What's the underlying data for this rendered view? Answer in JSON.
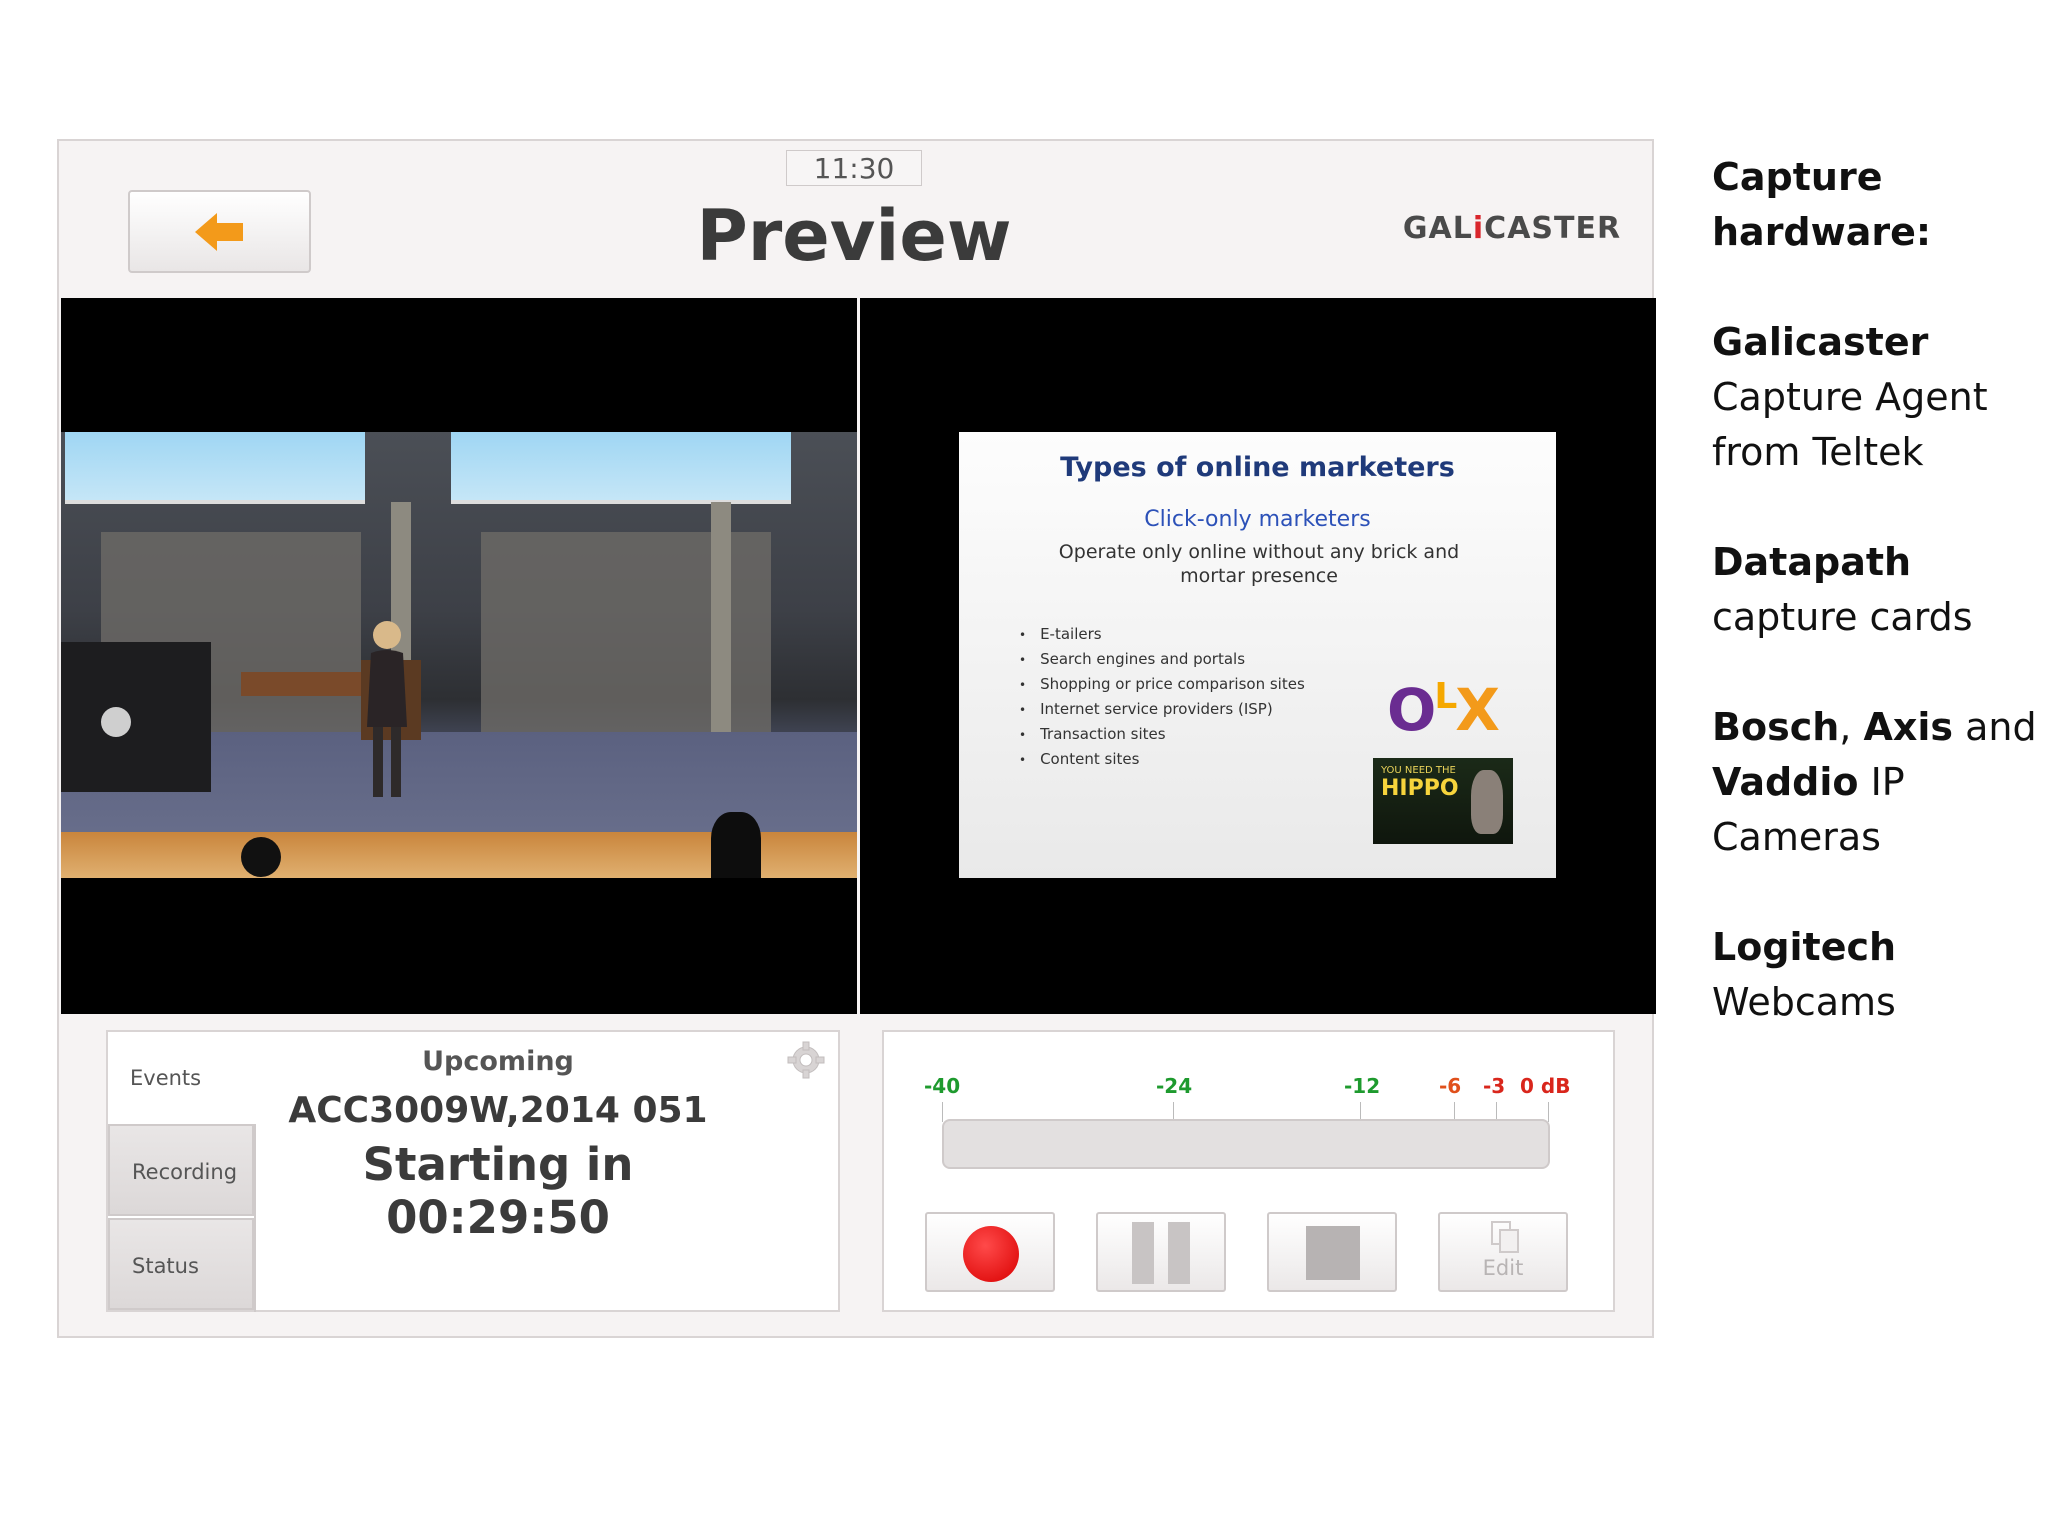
{
  "header": {
    "clock": "11:30",
    "title": "Preview",
    "brand_prefix": "GAL",
    "brand_i": "i",
    "brand_suffix": "CASTER"
  },
  "slide": {
    "title": "Types of online marketers",
    "subtitle": "Click-only marketers",
    "description": "Operate only online without any brick and mortar presence",
    "bullets": [
      "E-tailers",
      "Search engines and portals",
      "Shopping or price comparison sites",
      "Internet service providers (ISP)",
      "Transaction sites",
      "Content sites"
    ],
    "logo_olx_o": "O",
    "logo_olx_l": "L",
    "logo_olx_x": "X",
    "hippo_small": "YOU NEED THE",
    "hippo_big": "HIPPO"
  },
  "events": {
    "tabs": [
      "Events",
      "Recording",
      "Status"
    ],
    "heading": "Upcoming",
    "code": "ACC3009W,2014 051",
    "countdown": "Starting in 00:29:50"
  },
  "audio_meter": {
    "ticks": [
      "-40",
      "-24",
      "-12",
      "-6",
      "-3",
      "0 dB"
    ],
    "tick_colors": [
      "#1e9a2e",
      "#1e9a2e",
      "#1e9a2e",
      "#e0501b",
      "#d9261c",
      "#d9261c"
    ],
    "level": 0
  },
  "controls": {
    "edit_label": "Edit"
  },
  "notes": [
    {
      "bold": "Capture hardware:",
      "rest": ""
    },
    {
      "bold": "Galicaster",
      "rest": "Capture Agent from Teltek"
    },
    {
      "bold": "Datapath",
      "rest": "capture cards"
    },
    {
      "bold": "Bosch",
      "mid1": ", ",
      "bold2": "Axis",
      "mid2": " and ",
      "bold3": "Vaddio",
      "rest": " IP Cameras"
    },
    {
      "bold": "Logitech",
      "rest": "Webcams"
    }
  ]
}
